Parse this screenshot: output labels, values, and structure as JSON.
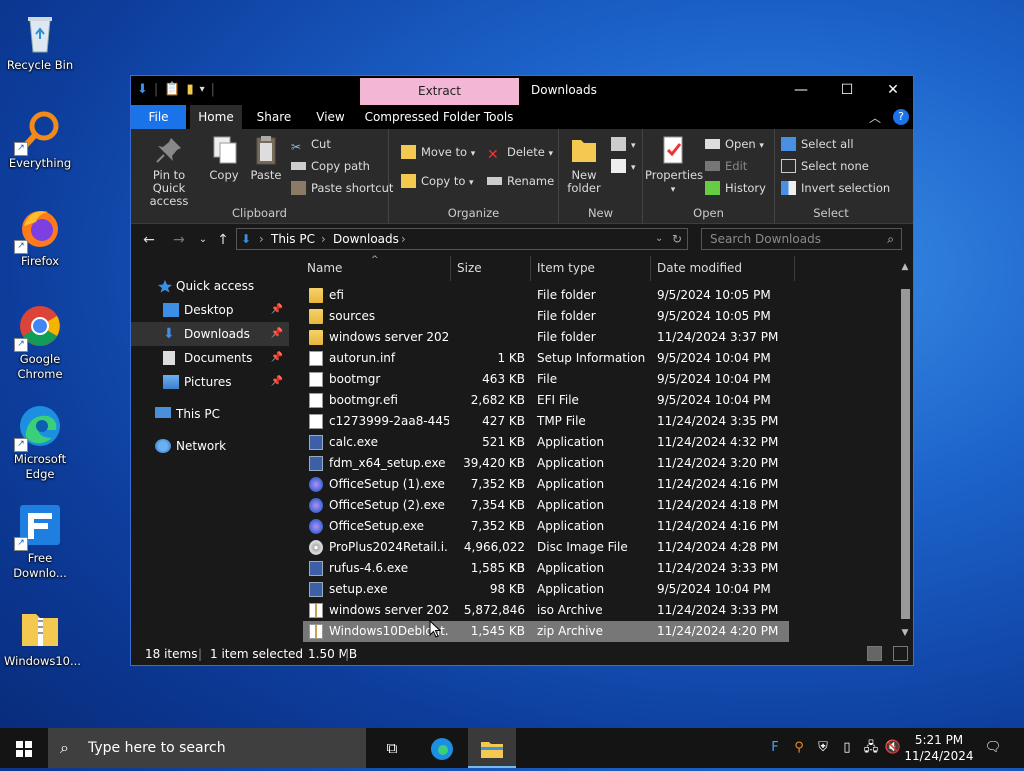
{
  "desktop": {
    "icons": [
      {
        "label": "Recycle Bin"
      },
      {
        "label": "Everything"
      },
      {
        "label": "Firefox"
      },
      {
        "label": "Google Chrome"
      },
      {
        "label": "Microsoft Edge"
      },
      {
        "label": "Free Downlo..."
      },
      {
        "label": "Windows10..."
      }
    ]
  },
  "window": {
    "title": "Downloads",
    "contextual_tab_header": "Extract",
    "tabs": [
      "File",
      "Home",
      "Share",
      "View",
      "Compressed Folder Tools"
    ],
    "ribbon": {
      "clipboard": {
        "group": "Clipboard",
        "pin": "Pin to Quick access",
        "copy": "Copy",
        "paste": "Paste",
        "cut": "Cut",
        "copy_path": "Copy path",
        "paste_shortcut": "Paste shortcut"
      },
      "organize": {
        "group": "Organize",
        "move_to": "Move to",
        "copy_to": "Copy to",
        "delete": "Delete",
        "rename": "Rename"
      },
      "new": {
        "group": "New",
        "new_folder": "New folder"
      },
      "open": {
        "group": "Open",
        "properties": "Properties",
        "open": "Open",
        "edit": "Edit",
        "history": "History"
      },
      "select": {
        "group": "Select",
        "select_all": "Select all",
        "select_none": "Select none",
        "invert": "Invert selection"
      }
    },
    "address": {
      "crumbs": [
        "This PC",
        "Downloads"
      ],
      "search_placeholder": "Search Downloads"
    },
    "nav_pane": {
      "quick_access": "Quick access",
      "desktop": "Desktop",
      "downloads": "Downloads",
      "documents": "Documents",
      "pictures": "Pictures",
      "this_pc": "This PC",
      "network": "Network"
    },
    "columns": {
      "name": "Name",
      "size": "Size",
      "type": "Item type",
      "date": "Date modified"
    },
    "files": [
      {
        "name": "efi",
        "size": "",
        "type": "File folder",
        "date": "9/5/2024 10:05 PM",
        "icon": "folder"
      },
      {
        "name": "sources",
        "size": "",
        "type": "File folder",
        "date": "9/5/2024 10:05 PM",
        "icon": "folder"
      },
      {
        "name": "windows server 202...",
        "size": "",
        "type": "File folder",
        "date": "11/24/2024 3:37 PM",
        "icon": "folder"
      },
      {
        "name": "autorun.inf",
        "size": "1 KB",
        "type": "Setup Information",
        "date": "9/5/2024 10:04 PM",
        "icon": "setup-file"
      },
      {
        "name": "bootmgr",
        "size": "463 KB",
        "type": "File",
        "date": "9/5/2024 10:04 PM",
        "icon": "file"
      },
      {
        "name": "bootmgr.efi",
        "size": "2,682 KB",
        "type": "EFI File",
        "date": "9/5/2024 10:04 PM",
        "icon": "file"
      },
      {
        "name": "c1273999-2aa8-445...",
        "size": "427 KB",
        "type": "TMP File",
        "date": "11/24/2024 3:35 PM",
        "icon": "file"
      },
      {
        "name": "calc.exe",
        "size": "521 KB",
        "type": "Application",
        "date": "11/24/2024 4:32 PM",
        "icon": "exe"
      },
      {
        "name": "fdm_x64_setup.exe",
        "size": "39,420 KB",
        "type": "Application",
        "date": "11/24/2024 3:20 PM",
        "icon": "exe"
      },
      {
        "name": "OfficeSetup (1).exe",
        "size": "7,352 KB",
        "type": "Application",
        "date": "11/24/2024 4:16 PM",
        "icon": "office"
      },
      {
        "name": "OfficeSetup (2).exe",
        "size": "7,354 KB",
        "type": "Application",
        "date": "11/24/2024 4:18 PM",
        "icon": "office"
      },
      {
        "name": "OfficeSetup.exe",
        "size": "7,352 KB",
        "type": "Application",
        "date": "11/24/2024 4:16 PM",
        "icon": "office"
      },
      {
        "name": "ProPlus2024Retail.i...",
        "size": "4,966,022 KB",
        "type": "Disc Image File",
        "date": "11/24/2024 4:28 PM",
        "icon": "disc"
      },
      {
        "name": "rufus-4.6.exe",
        "size": "1,585 KB",
        "type": "Application",
        "date": "11/24/2024 3:33 PM",
        "icon": "exe"
      },
      {
        "name": "setup.exe",
        "size": "98 KB",
        "type": "Application",
        "date": "9/5/2024 10:04 PM",
        "icon": "exe"
      },
      {
        "name": "windows server 202...",
        "size": "5,872,846 KB",
        "type": "iso Archive",
        "date": "11/24/2024 3:33 PM",
        "icon": "zip"
      },
      {
        "name": "Windows10Debloat...",
        "size": "1,545 KB",
        "type": "zip Archive",
        "date": "11/24/2024 4:20 PM",
        "icon": "zip"
      }
    ],
    "status": {
      "items": "18 items",
      "selected": "1 item selected",
      "size": "1.50 MB"
    }
  },
  "taskbar": {
    "search_placeholder": "Type here to search",
    "time": "5:21 PM",
    "date": "11/24/2024"
  },
  "colors": {
    "accent": "#1a73e8",
    "contextual_tab": "#f4b6d5",
    "selection": "#777777"
  }
}
